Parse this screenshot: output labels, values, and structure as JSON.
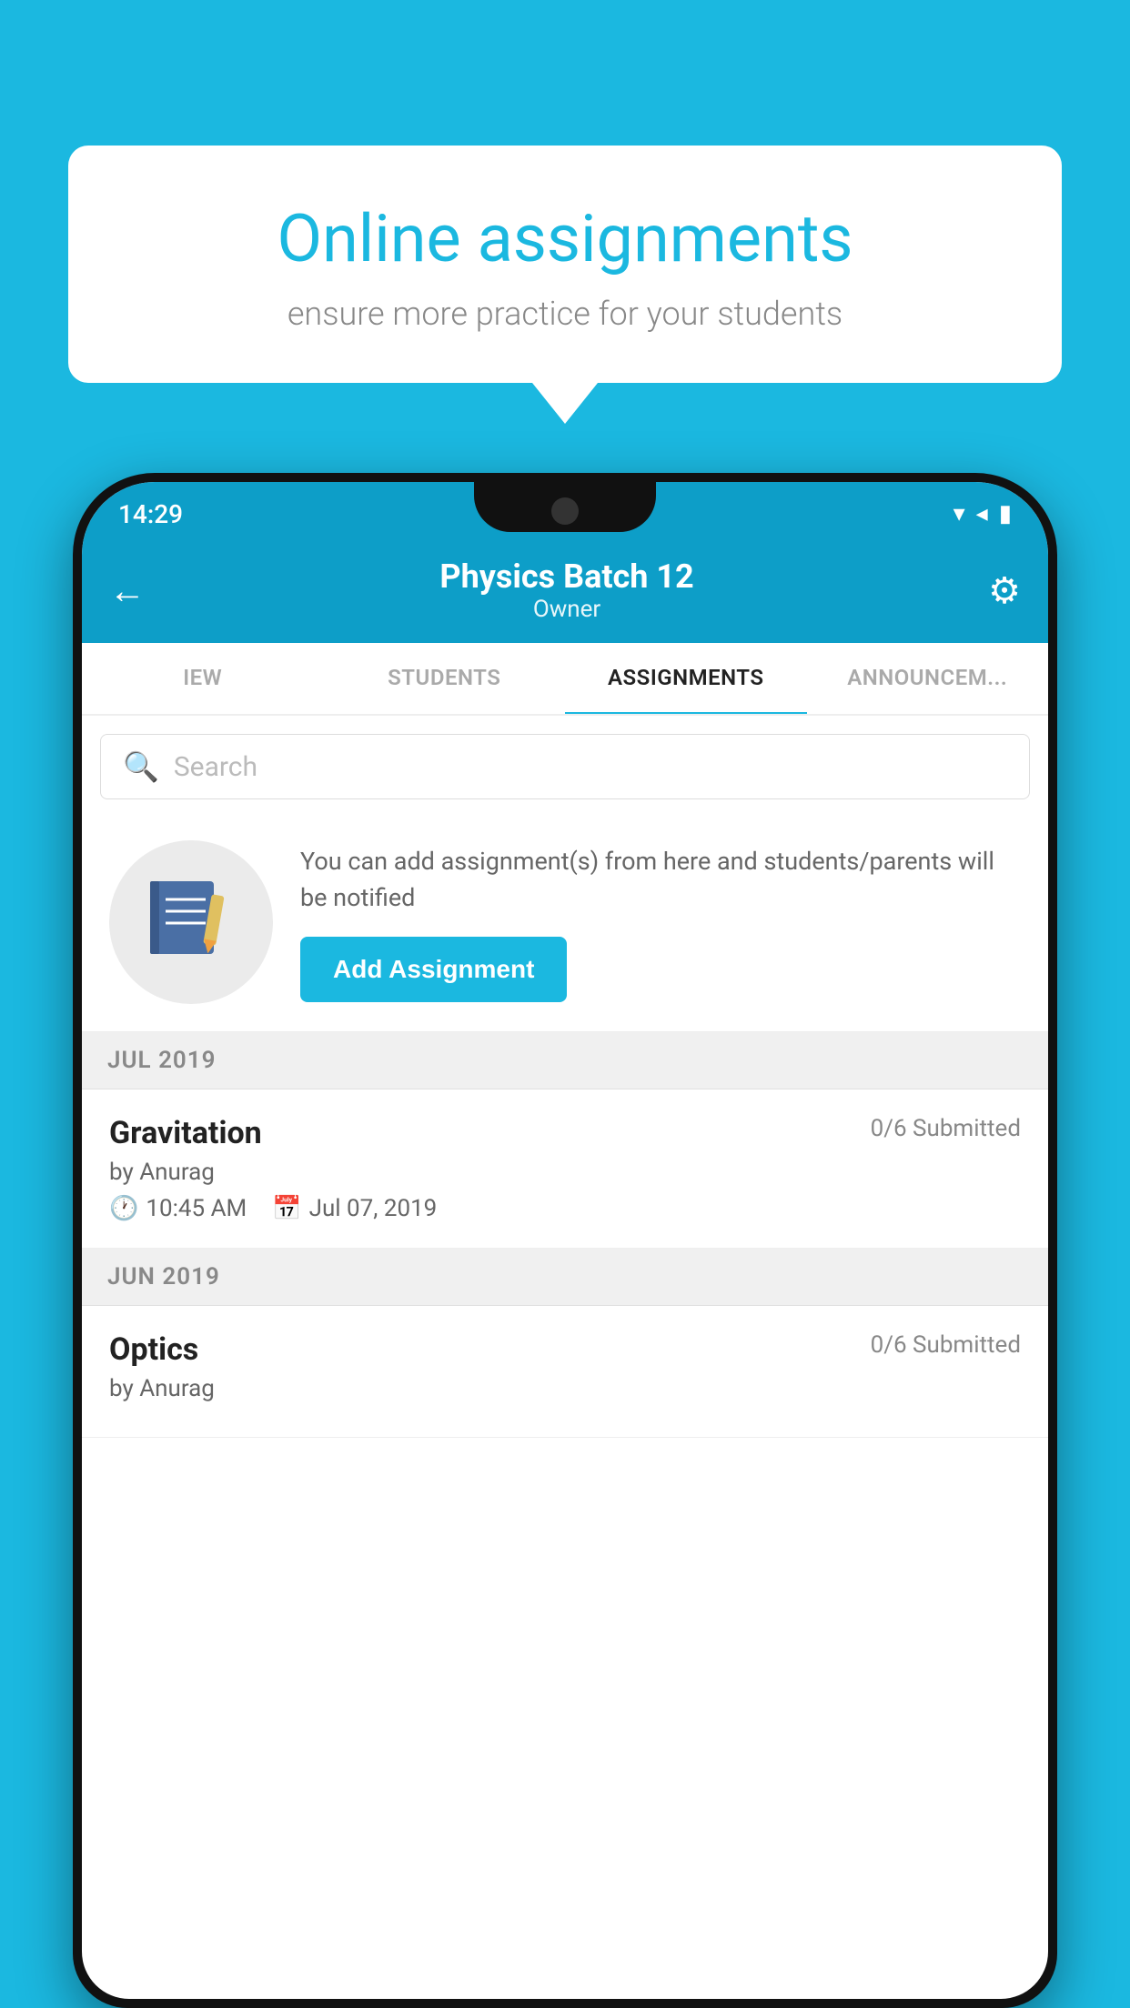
{
  "background_color": "#1bb8e0",
  "speech_bubble": {
    "title": "Online assignments",
    "subtitle": "ensure more practice for your students"
  },
  "status_bar": {
    "time": "14:29",
    "icons": [
      "wifi",
      "signal",
      "battery"
    ]
  },
  "app_header": {
    "title": "Physics Batch 12",
    "subtitle": "Owner",
    "back_label": "←",
    "gear_label": "⚙"
  },
  "tabs": [
    {
      "label": "IEW",
      "active": false
    },
    {
      "label": "STUDENTS",
      "active": false
    },
    {
      "label": "ASSIGNMENTS",
      "active": true
    },
    {
      "label": "ANNOUNCEMENTS",
      "active": false
    }
  ],
  "search": {
    "placeholder": "Search"
  },
  "promo": {
    "text": "You can add assignment(s) from here and students/parents will be notified",
    "button_label": "Add Assignment"
  },
  "sections": [
    {
      "label": "JUL 2019",
      "assignments": [
        {
          "name": "Gravitation",
          "submitted": "0/6 Submitted",
          "by": "by Anurag",
          "time": "10:45 AM",
          "date": "Jul 07, 2019"
        }
      ]
    },
    {
      "label": "JUN 2019",
      "assignments": [
        {
          "name": "Optics",
          "submitted": "0/6 Submitted",
          "by": "by Anurag",
          "time": "",
          "date": ""
        }
      ]
    }
  ]
}
